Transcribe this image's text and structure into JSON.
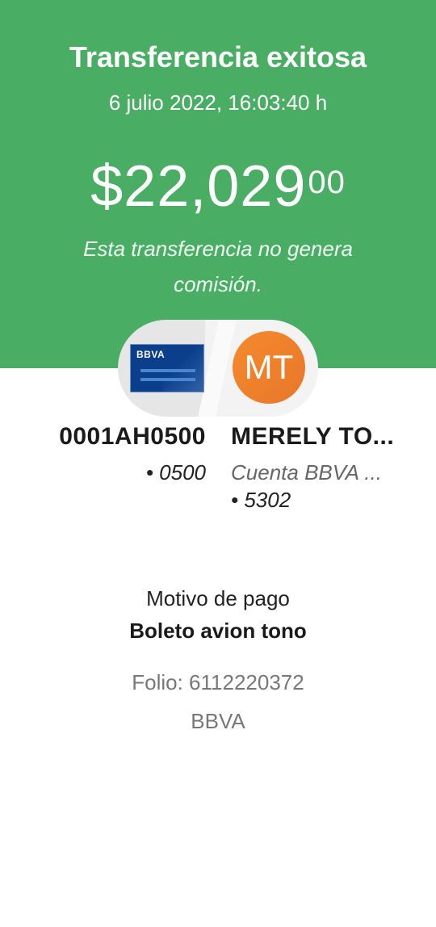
{
  "header": {
    "title": "Transferencia exitosa",
    "datetime": "6 julio 2022, 16:03:40 h",
    "amount_main": "$22,029",
    "amount_cents": "00",
    "commission_note": "Esta transferencia no genera comisión.",
    "background_color": "#49ae64"
  },
  "origin": {
    "card_brand": "BBVA",
    "name": "0001AH0500",
    "account": "• 0500"
  },
  "destination": {
    "avatar_initials": "MT",
    "avatar_color": "#f0802c",
    "name": "MERELY TO...",
    "bank": "Cuenta BBVA ...",
    "account": "• 5302"
  },
  "details": {
    "motive_label": "Motivo de pago",
    "motive_value": "Boleto avion tono",
    "folio": "Folio: 6112220372",
    "bank": "BBVA"
  }
}
